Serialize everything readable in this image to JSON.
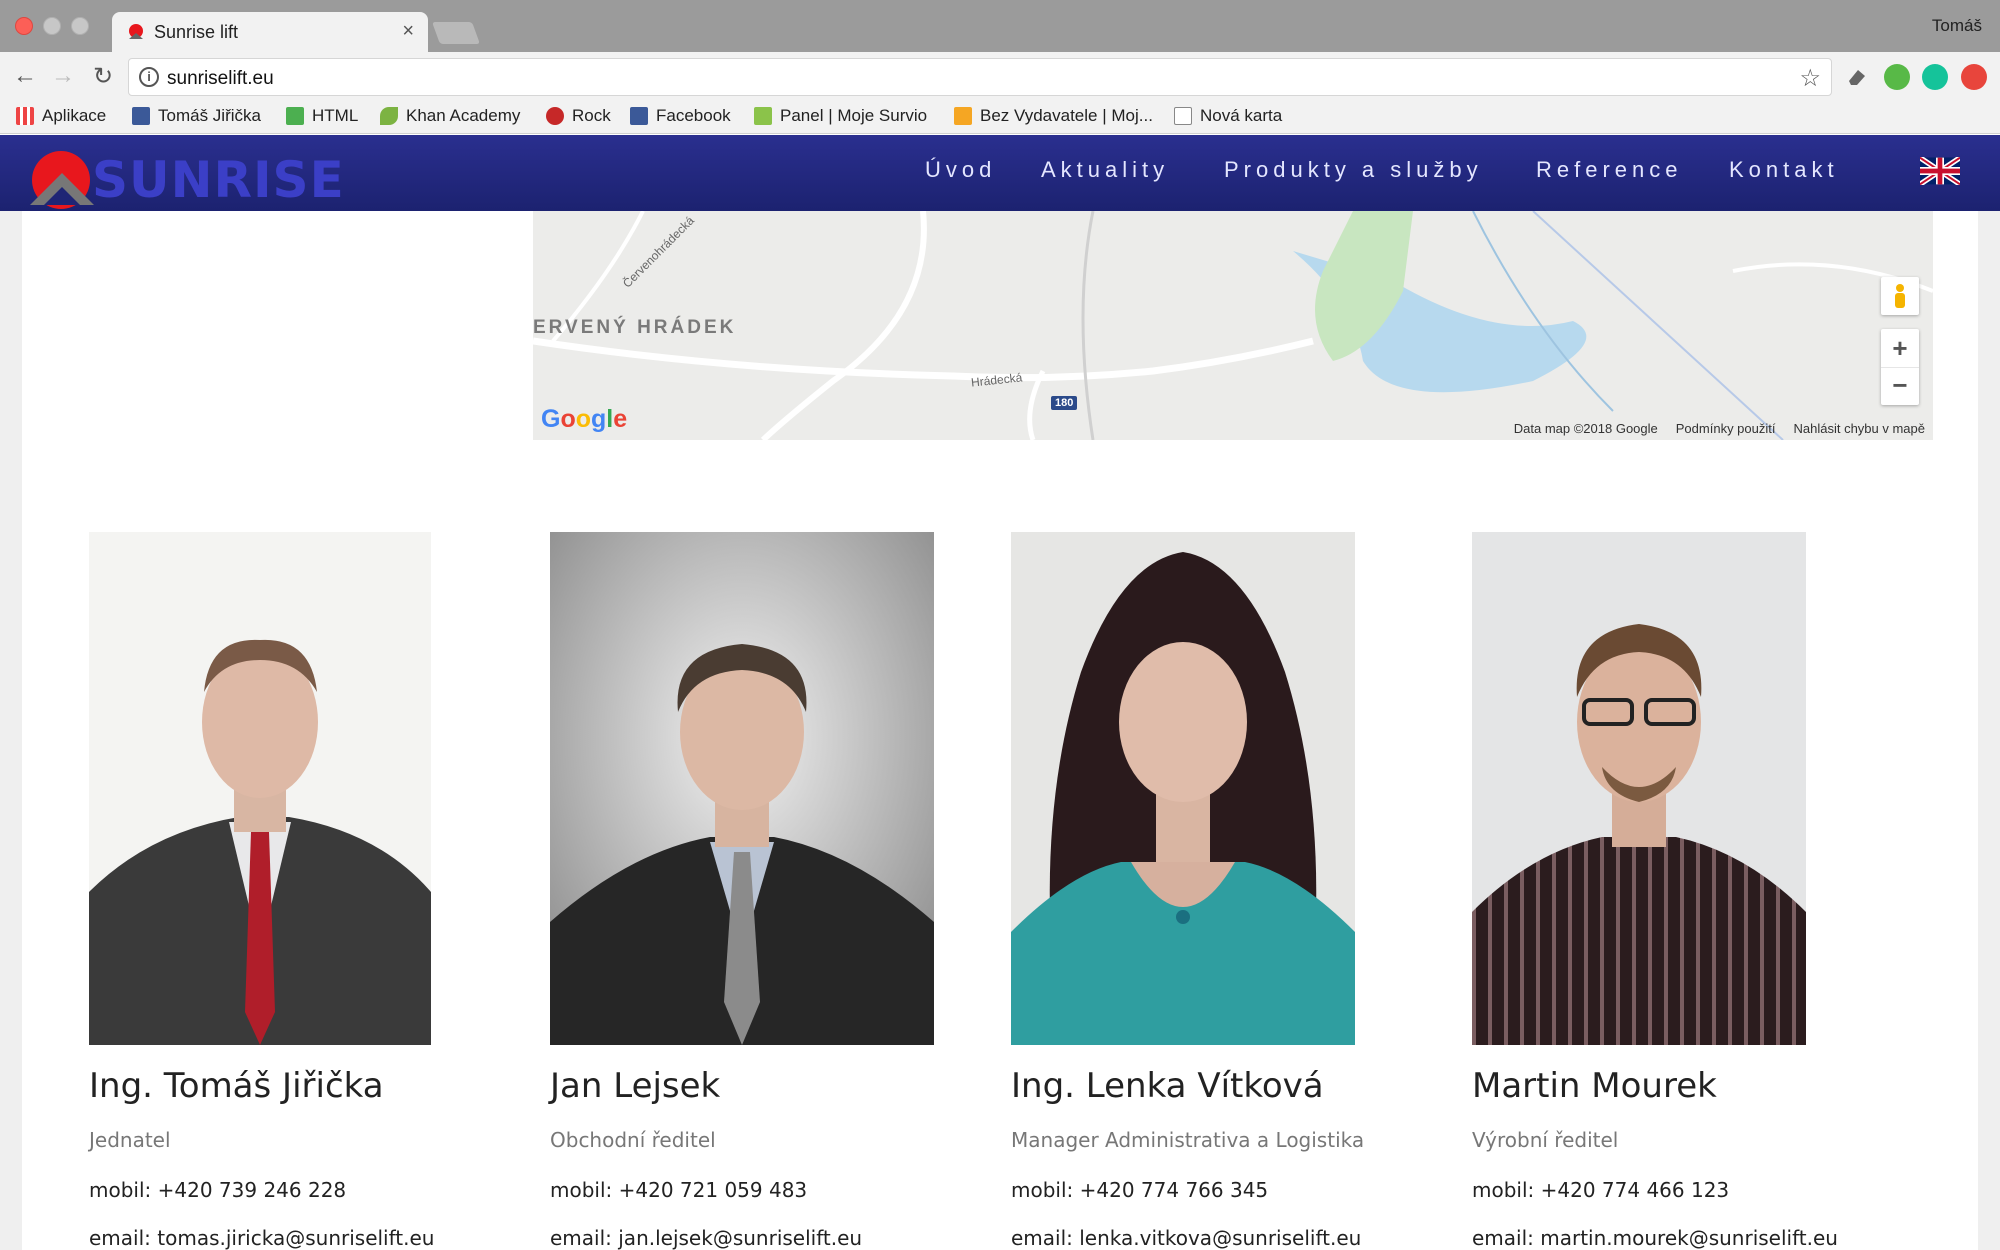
{
  "browser": {
    "tab_title": "Sunrise lift",
    "tab_close": "×",
    "profile_name": "Tomáš",
    "url": "sunriselift.eu",
    "bookmarks": [
      "Aplikace",
      "Tomáš Jiřička",
      "HTML",
      "Khan Academy",
      "Rock",
      "Facebook",
      "Panel | Moje Survio",
      "Bez Vydavatele | Moj...",
      "Nová karta"
    ]
  },
  "site": {
    "logo_text": "SUNRISE",
    "nav": [
      "Úvod",
      "Aktuality",
      "Produkty a služby",
      "Reference",
      "Kontakt"
    ],
    "language_icon": "uk-flag-icon"
  },
  "map": {
    "town_label": "ERVENÝ HRÁDEK",
    "road_label_1": "Červenohrádecká",
    "road_label_2": "Hrádecká",
    "road_number": "180",
    "google_logo": "Google",
    "footer": [
      "Data map ©2018 Google",
      "Podmínky použití",
      "Nahlásit chybu v mapě"
    ],
    "zoom_in": "+",
    "zoom_out": "−"
  },
  "team": [
    {
      "name": "Ing. Tomáš Jiřička",
      "role": "Jednatel",
      "mobile": "mobil: +420 739 246 228",
      "email": "email: tomas.jiricka@sunriselift.eu"
    },
    {
      "name": "Jan Lejsek",
      "role": "Obchodní ředitel",
      "mobile": "mobil: +420 721 059 483",
      "email": "email: jan.lejsek@sunriselift.eu"
    },
    {
      "name": "Ing. Lenka Vítková",
      "role": "Manager Administrativa a Logistika",
      "mobile": "mobil: +420 774 766 345",
      "email": "email: lenka.vitkova@sunriselift.eu"
    },
    {
      "name": "Martin Mourek",
      "role": "Výrobní ředitel",
      "mobile": "mobil: +420 774 466 123",
      "email": "email: martin.mourek@sunriselift.eu"
    }
  ],
  "colors": {
    "header_bg": "#1f2575",
    "logo_red": "#e8171d",
    "logo_blue": "#3b3fc7"
  }
}
